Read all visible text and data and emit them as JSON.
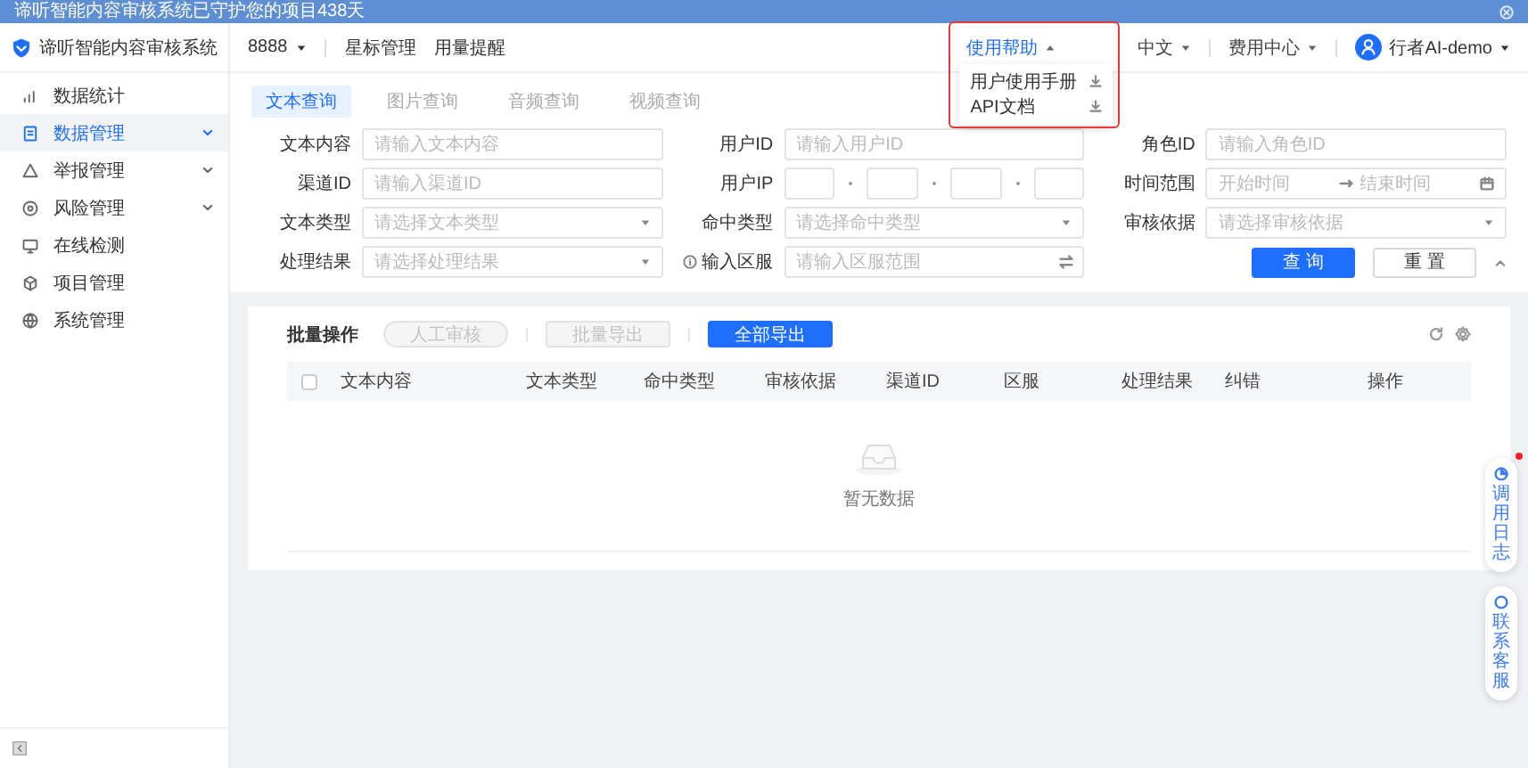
{
  "banner": {
    "text": "谛听智能内容审核系统已守护您的项目438天"
  },
  "brand": {
    "name": "谛听智能内容审核系统"
  },
  "header": {
    "project": "8888",
    "links": [
      "星标管理",
      "用量提醒"
    ],
    "menus": [
      {
        "label": "使用帮助",
        "expanded": true,
        "highlighted": true,
        "items": [
          "用户使用手册",
          "API文档"
        ]
      },
      {
        "label": "中文",
        "expanded": false,
        "highlighted": false
      },
      {
        "label": "费用中心",
        "expanded": false,
        "highlighted": false
      }
    ],
    "user": "行者AI-demo"
  },
  "sidebar": {
    "items": [
      {
        "label": "数据统计",
        "selected": false,
        "has_children": false
      },
      {
        "label": "数据管理",
        "selected": true,
        "has_children": true
      },
      {
        "label": "举报管理",
        "selected": false,
        "has_children": true
      },
      {
        "label": "风险管理",
        "selected": false,
        "has_children": true
      },
      {
        "label": "在线检测",
        "selected": false,
        "has_children": false
      },
      {
        "label": "项目管理",
        "selected": false,
        "has_children": false
      },
      {
        "label": "系统管理",
        "selected": false,
        "has_children": false
      }
    ]
  },
  "tabs": [
    {
      "label": "文本查询",
      "selected": true
    },
    {
      "label": "图片查询",
      "selected": false
    },
    {
      "label": "音频查询",
      "selected": false
    },
    {
      "label": "视频查询",
      "selected": false
    }
  ],
  "form": {
    "fields": [
      {
        "label": "文本内容",
        "kind": "text",
        "placeholder": "请输入文本内容"
      },
      {
        "label": "用户ID",
        "kind": "text",
        "placeholder": "请输入用户ID"
      },
      {
        "label": "角色ID",
        "kind": "text",
        "placeholder": "请输入角色ID"
      },
      {
        "label": "渠道ID",
        "kind": "text",
        "placeholder": "请输入渠道ID"
      },
      {
        "label": "用户IP",
        "kind": "ip"
      },
      {
        "label": "时间范围",
        "kind": "range",
        "placeholder": "开始时间",
        "end_placeholder": "结束时间"
      },
      {
        "label": "文本类型",
        "kind": "select",
        "placeholder": "请选择文本类型"
      },
      {
        "label": "命中类型",
        "kind": "select",
        "placeholder": "请选择命中类型"
      },
      {
        "label": "审核依据",
        "kind": "select",
        "placeholder": "请选择审核依据"
      },
      {
        "label": "处理结果",
        "kind": "select",
        "placeholder": "请选择处理结果"
      },
      {
        "label": "输入区服",
        "kind": "search",
        "placeholder": "请输入区服范围",
        "info": true
      }
    ],
    "buttons": [
      {
        "label": "查 询",
        "primary": true
      },
      {
        "label": "重 置",
        "primary": false
      }
    ]
  },
  "table": {
    "title": "批量操作",
    "actions": [
      {
        "label": "人工审核",
        "disabled": true
      },
      {
        "label": "批量导出",
        "disabled": true
      },
      {
        "label": "全部导出",
        "disabled": false
      }
    ],
    "select_all": {
      "checked": false
    },
    "columns": [
      "文本内容",
      "文本类型",
      "命中类型",
      "审核依据",
      "渠道ID",
      "区服",
      "处理结果",
      "纠错",
      "操作"
    ],
    "empty_text": "暂无数据"
  },
  "float_buttons": [
    {
      "label": "调用日志",
      "badge": true
    },
    {
      "label": "联系客服",
      "badge": false
    }
  ]
}
